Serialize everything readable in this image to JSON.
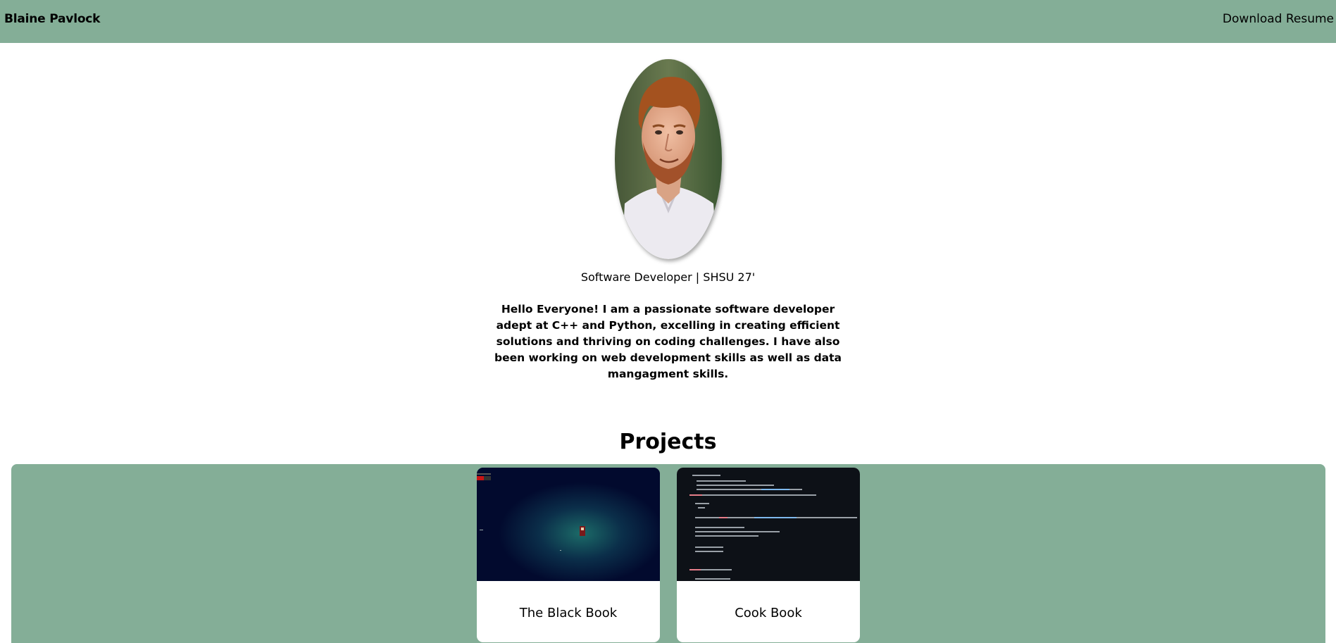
{
  "header": {
    "brand": "Blaine Pavlock",
    "resume_link": "Download Resume"
  },
  "profile": {
    "tagline": "Software Developer | SHSU 27'",
    "bio": "Hello Everyone! I am a passionate software developer adept at C++ and Python, excelling in creating efficient solutions and thriving on coding challenges. I have also been working on web development skills as well as data mangagment skills."
  },
  "projects": {
    "heading": "Projects",
    "items": [
      {
        "title": "The Black Book"
      },
      {
        "title": "Cook Book"
      }
    ]
  },
  "colors": {
    "accent": "#84ae97",
    "game_bg": "#020a2e",
    "code_bg": "#0d1117"
  }
}
